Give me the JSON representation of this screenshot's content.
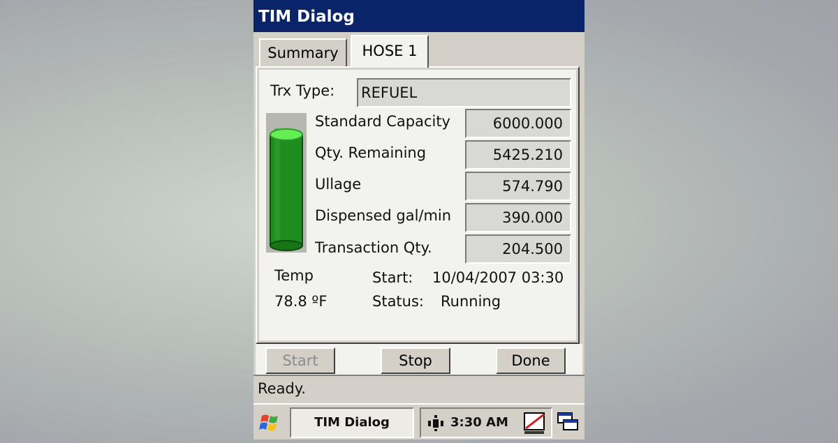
{
  "window": {
    "title": "TIM Dialog"
  },
  "tabs": [
    {
      "label": "Summary",
      "active": false
    },
    {
      "label": "HOSE 1",
      "active": true
    }
  ],
  "form": {
    "trx_type_label": "Trx Type:",
    "trx_type_value": "REFUEL",
    "fields": [
      {
        "label": "Standard Capacity",
        "value": "6000.000"
      },
      {
        "label": "Qty. Remaining",
        "value": "5425.210"
      },
      {
        "label": "Ullage",
        "value": "574.790"
      },
      {
        "label": "Dispensed gal/min",
        "value": "390.000"
      },
      {
        "label": "Transaction Qty.",
        "value": "204.500"
      }
    ],
    "tank_fill_fraction": 0.904,
    "temp_label": "Temp",
    "temp_value": "78.8 ºF",
    "start_label": "Start:",
    "start_value": "10/04/2007 03:30",
    "status_label": "Status:",
    "status_value": "Running"
  },
  "buttons": {
    "start": {
      "label": "Start",
      "enabled": false
    },
    "stop": {
      "label": "Stop",
      "enabled": true
    },
    "done": {
      "label": "Done",
      "enabled": true
    }
  },
  "status_bar": {
    "text": "Ready."
  },
  "taskbar": {
    "start_icon": "windows-flag-icon",
    "task_label": "TIM Dialog",
    "clock": "3:30 AM",
    "tray_icons": [
      "network-icon",
      "pen-input-icon",
      "desktop-windows-icon"
    ]
  },
  "colors": {
    "titlebar": "#0a246a",
    "tank_liquid": "#1f8c1f",
    "tank_top": "#66ee55"
  }
}
